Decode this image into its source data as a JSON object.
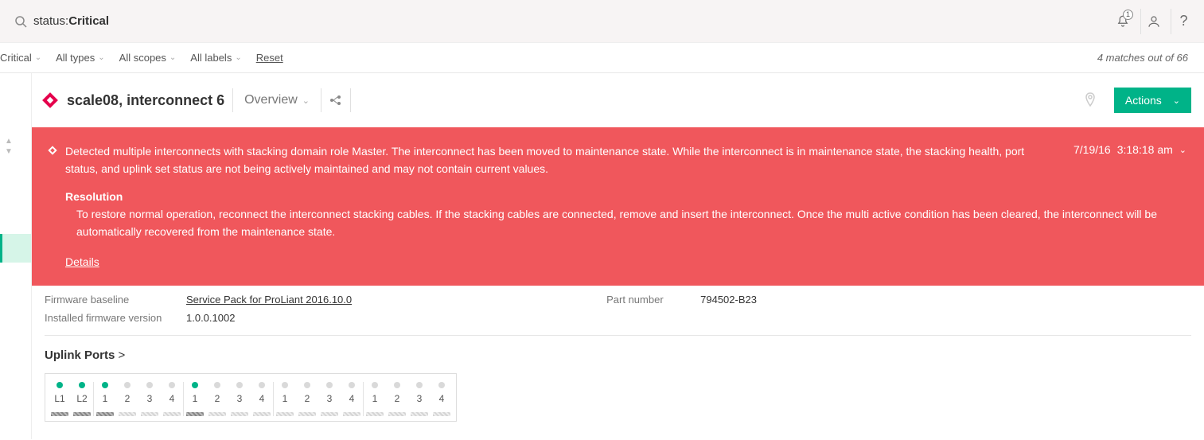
{
  "search": {
    "prefix": "status:",
    "value": "Critical"
  },
  "topbar": {
    "notif_count": "1"
  },
  "filters": {
    "status": "Critical",
    "types": "All types",
    "scopes": "All scopes",
    "labels": "All labels",
    "reset": "Reset",
    "matches": "4 matches out of 66"
  },
  "header": {
    "title": "scale08, interconnect 6",
    "view": "Overview",
    "actions": "Actions"
  },
  "alert": {
    "message": "Detected multiple interconnects with stacking domain role Master. The interconnect has been moved to maintenance state. While the interconnect is in maintenance state, the stacking health, port status, and uplink set status are not being actively maintained and may not contain current values.",
    "date": "7/19/16",
    "time": "3:18:18 am",
    "resolution_label": "Resolution",
    "resolution_body": "To restore normal operation, reconnect the interconnect stacking cables. If the stacking cables are connected, remove and insert the interconnect. Once the multi active condition has been cleared, the interconnect will be automatically recovered from the maintenance state.",
    "details": "Details"
  },
  "props": {
    "fw_baseline_label": "Firmware baseline",
    "fw_baseline_value": "Service Pack for ProLiant 2016.10.0",
    "fw_installed_label": "Installed firmware version",
    "fw_installed_value": "1.0.0.1002",
    "part_label": "Part number",
    "part_value": "794502-B23"
  },
  "uplink": {
    "title": "Uplink Ports",
    "groups": [
      {
        "ports": [
          {
            "label": "L1",
            "green": true
          },
          {
            "label": "L2",
            "green": true
          }
        ]
      },
      {
        "ports": [
          {
            "label": "1",
            "green": true
          },
          {
            "label": "2",
            "green": false
          },
          {
            "label": "3",
            "green": false
          },
          {
            "label": "4",
            "green": false
          }
        ]
      },
      {
        "ports": [
          {
            "label": "1",
            "green": true
          },
          {
            "label": "2",
            "green": false
          },
          {
            "label": "3",
            "green": false
          },
          {
            "label": "4",
            "green": false
          }
        ]
      },
      {
        "ports": [
          {
            "label": "1",
            "green": false
          },
          {
            "label": "2",
            "green": false
          },
          {
            "label": "3",
            "green": false
          },
          {
            "label": "4",
            "green": false
          }
        ]
      },
      {
        "ports": [
          {
            "label": "1",
            "green": false
          },
          {
            "label": "2",
            "green": false
          },
          {
            "label": "3",
            "green": false
          },
          {
            "label": "4",
            "green": false
          }
        ]
      }
    ]
  }
}
